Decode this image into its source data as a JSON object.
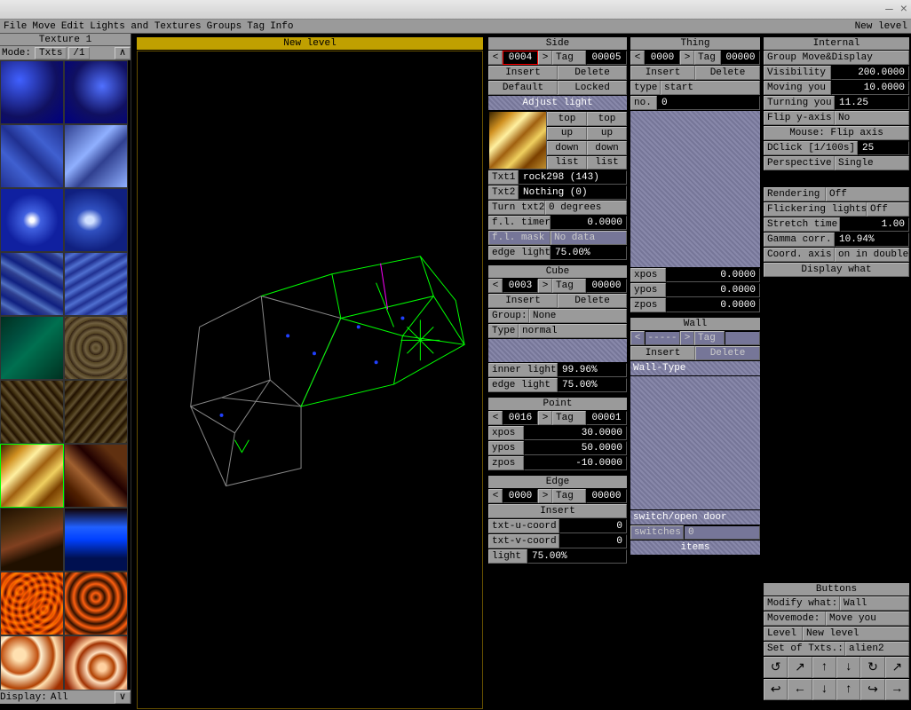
{
  "menubar": {
    "items": [
      "File",
      "Move",
      "Edit",
      "Lights and Textures",
      "Groups",
      "Tag",
      "Info"
    ],
    "right": "New level"
  },
  "palette": {
    "title": "Texture 1",
    "mode_label": "Mode:",
    "mode_value": "Txts",
    "mode_extra": "/1",
    "footer_label": "Display:",
    "footer_value": "All"
  },
  "viewport": {
    "title": "New level"
  },
  "side": {
    "title": "Side",
    "id": "0004",
    "tag_label": "Tag",
    "tag": "00005",
    "insert": "Insert",
    "delete": "Delete",
    "default": "Default",
    "locked": "Locked",
    "adjust": "Adjust light",
    "btns": {
      "top": "top",
      "up": "up",
      "down": "down",
      "list": "list"
    },
    "txt1_label": "Txt1",
    "txt1": "rock298 (143)",
    "txt2_label": "Txt2",
    "txt2": "Nothing (0)",
    "turn_label": "Turn txt2",
    "turn_val": "0 degrees",
    "fl_timer_label": "f.l. timer",
    "fl_timer": "0.0000",
    "fl_mask_label": "f.l. mask",
    "fl_mask": "No data",
    "edge_light_label": "edge light",
    "edge_light": "75.00%"
  },
  "cube": {
    "title": "Cube",
    "id": "0003",
    "tag_label": "Tag",
    "tag": "00000",
    "insert": "Insert",
    "delete": "Delete",
    "group_label": "Group:",
    "group": "None",
    "type_label": "Type",
    "type": "normal",
    "inner_label": "inner light",
    "inner": "99.96%",
    "edge_label": "edge light",
    "edge": "75.00%"
  },
  "point": {
    "title": "Point",
    "id": "0016",
    "tag_label": "Tag",
    "tag": "00001",
    "xpos_label": "xpos",
    "xpos": "30.0000",
    "ypos_label": "ypos",
    "ypos": "50.0000",
    "zpos_label": "zpos",
    "zpos": "-10.0000"
  },
  "edge": {
    "title": "Edge",
    "id": "0000",
    "tag_label": "Tag",
    "tag": "00000",
    "insert": "Insert",
    "u_label": "txt-u-coord",
    "u": "0",
    "v_label": "txt-v-coord",
    "v": "0",
    "light_label": "light",
    "light": "75.00%"
  },
  "thing": {
    "title": "Thing",
    "id": "0000",
    "tag_label": "Tag",
    "tag": "00000",
    "insert": "Insert",
    "delete": "Delete",
    "type_label": "type",
    "type": "start",
    "no_label": "no.",
    "no": "0",
    "xpos_label": "xpos",
    "xpos": "0.0000",
    "ypos_label": "ypos",
    "ypos": "0.0000",
    "zpos_label": "zpos",
    "zpos": "0.0000"
  },
  "wall": {
    "title": "Wall",
    "tag_label": "Tag",
    "id": "-----",
    "insert": "Insert",
    "delete": "Delete",
    "walltype": "Wall-Type",
    "switch_label": "switch/open door",
    "switches_label": "switches",
    "switches": "0",
    "items": "items"
  },
  "internal": {
    "title": "Internal",
    "group": "Group Move&Display",
    "vis_label": "Visibility",
    "vis": "200.0000",
    "moving_label": "Moving you",
    "moving": "10.0000",
    "turning_label": "Turning you",
    "turning": "11.25",
    "flip_label": "Flip y-axis",
    "flip": "No",
    "mouse": "Mouse: Flip axis",
    "dclick_label": "DClick [1/100s]",
    "dclick": "25",
    "persp_label": "Perspective",
    "persp": "Single",
    "render_label": "Rendering",
    "render": "Off",
    "flicker_label": "Flickering lights",
    "flicker": "Off",
    "stretch_label": "Stretch time",
    "stretch": "1.00",
    "gamma_label": "Gamma corr.",
    "gamma": "10.94%",
    "coord_label": "Coord. axis",
    "coord": "on in double",
    "display_what": "Display what"
  },
  "buttons": {
    "title": "Buttons",
    "modify_label": "Modify what:",
    "modify": "Wall",
    "movemode_label": "Movemode:",
    "movemode": "Move you",
    "level_label": "Level",
    "level": "New level",
    "txtset_label": "Set of Txts.:",
    "txtset": "alien2"
  }
}
